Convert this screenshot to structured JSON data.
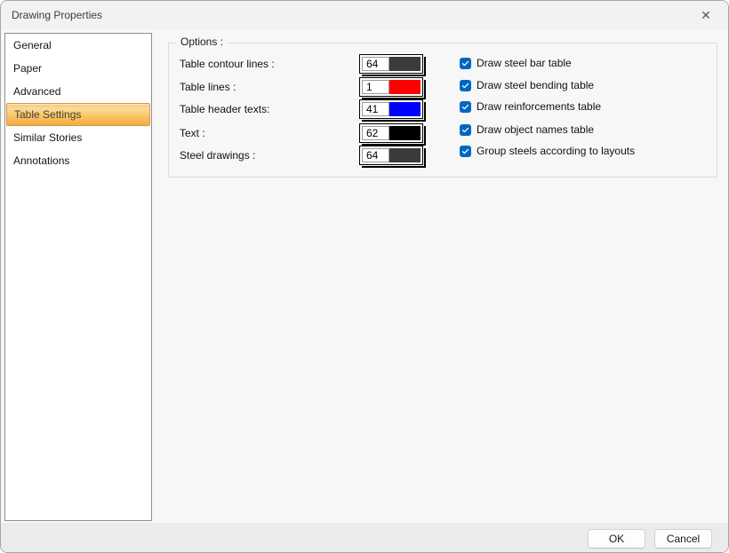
{
  "window": {
    "title": "Drawing Properties",
    "close_glyph": "✕"
  },
  "sidebar": {
    "items": [
      {
        "label": "General",
        "selected": false
      },
      {
        "label": "Paper",
        "selected": false
      },
      {
        "label": "Advanced",
        "selected": false
      },
      {
        "label": "Table Settings",
        "selected": true
      },
      {
        "label": "Similar Stories",
        "selected": false
      },
      {
        "label": "Annotations",
        "selected": false
      }
    ]
  },
  "panel": {
    "group_title": "Options :",
    "rows": [
      {
        "label": "Table contour lines :",
        "value": "64",
        "color": "#3b3b3b"
      },
      {
        "label": "Table lines :",
        "value": "1",
        "color": "#ff0000"
      },
      {
        "label": "Table header texts:",
        "value": "41",
        "color": "#0000ff"
      },
      {
        "label": "Text :",
        "value": "62",
        "color": "#000000"
      },
      {
        "label": "Steel drawings :",
        "value": "64",
        "color": "#3b3b3b"
      }
    ],
    "checkboxes": [
      {
        "label": "Draw steel bar table",
        "checked": true
      },
      {
        "label": "Draw steel bending table",
        "checked": true
      },
      {
        "label": "Draw reinforcements table",
        "checked": true
      },
      {
        "label": "Draw object names table",
        "checked": true
      },
      {
        "label": "Group steels according to layouts",
        "checked": true
      }
    ]
  },
  "footer": {
    "ok_label": "OK",
    "cancel_label": "Cancel"
  },
  "colors": {
    "checkbox_accent": "#0067c0",
    "selected_item_border": "#dc9639",
    "selected_item_gradient_top": "#fbda9b",
    "selected_item_gradient_bottom": "#f3ab43"
  }
}
